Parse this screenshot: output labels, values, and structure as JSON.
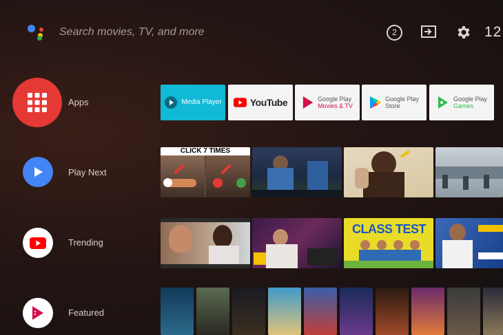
{
  "search": {
    "placeholder": "Search movies, TV, and more"
  },
  "status": {
    "notification_count": "2",
    "time": "12:"
  },
  "rows": [
    {
      "label": "Apps"
    },
    {
      "label": "Play Next"
    },
    {
      "label": "Trending"
    },
    {
      "label": "Featured"
    }
  ],
  "apps": [
    {
      "name": "Media Player",
      "lines": [
        "Media Player"
      ]
    },
    {
      "name": "YouTube",
      "lines": [
        "YouTube"
      ]
    },
    {
      "name": "Google Play Movies & TV",
      "lines": [
        "Google Play",
        "Movies & TV"
      ]
    },
    {
      "name": "Google Play Store",
      "lines": [
        "Google Play",
        "Store"
      ]
    },
    {
      "name": "Google Play Games",
      "lines": [
        "Google Play",
        "Games"
      ]
    }
  ],
  "play_next": {
    "first_caption": "CLICK 7 TIMES"
  },
  "trending": {
    "third_caption": "CLASS TEST"
  },
  "colors": {
    "apps_circle": "#e53935",
    "play_next_circle": "#4285f4",
    "trending_circle": "#ffffff",
    "featured_circle": "#ffffff",
    "youtube_red": "#ff0000",
    "play_movies_red": "#d50f4a"
  },
  "icons": [
    "google-assistant-icon",
    "notification-badge",
    "input-source-icon",
    "gear-icon",
    "apps-grid-icon",
    "play-icon",
    "youtube-icon",
    "play-movies-icon"
  ]
}
